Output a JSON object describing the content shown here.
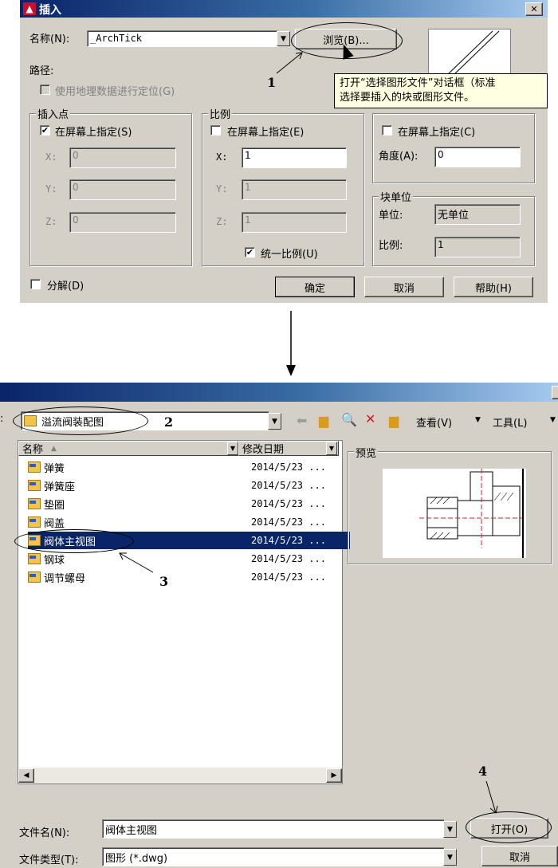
{
  "insert_dialog": {
    "title": "插入",
    "close_label": "✕",
    "name_label": "名称(N):",
    "name_value": "_ArchTick",
    "browse_button": "浏览(B)...",
    "path_label": "路径:",
    "geo_label": "使用地理数据进行定位(G)",
    "tooltip_line1": "打开“选择图形文件”对话框（标准",
    "tooltip_line2": "选择要插入的块或图形文件。",
    "insert_point": {
      "title": "插入点",
      "specify_label": "在屏幕上指定(S)",
      "specify_checked": "✔",
      "x_label": "X:",
      "x_value": "0",
      "y_label": "Y:",
      "y_value": "0",
      "z_label": "Z:",
      "z_value": "0"
    },
    "scale": {
      "title": "比例",
      "specify_label": "在屏幕上指定(E)",
      "x_label": "X:",
      "x_value": "1",
      "y_label": "Y:",
      "y_value": "1",
      "z_label": "Z:",
      "z_value": "1",
      "uniform_label": "统一比例(U)",
      "uniform_checked": "✔"
    },
    "rotation": {
      "specify_label": "在屏幕上指定(C)",
      "angle_label": "角度(A):",
      "angle_value": "0"
    },
    "block_unit": {
      "title": "块单位",
      "unit_label": "单位:",
      "unit_value": "无单位",
      "factor_label": "比例:",
      "factor_value": "1"
    },
    "explode_label": "分解(D)",
    "ok_button": "确定",
    "cancel_button": "取消",
    "help_button": "帮助(H)"
  },
  "annotations": {
    "n1": "1",
    "n2": "2",
    "n3": "3",
    "n4": "4"
  },
  "file_dialog": {
    "location_value": "溢流阀装配图",
    "view_menu": "查看(V)",
    "tools_menu": "工具(L)",
    "col_name": "名称",
    "col_date": "修改日期",
    "preview_label": "预览",
    "files": [
      {
        "name": "弹簧",
        "date": "2014/5/23 ..."
      },
      {
        "name": "弹簧座",
        "date": "2014/5/23 ..."
      },
      {
        "name": "垫圈",
        "date": "2014/5/23 ..."
      },
      {
        "name": "阀盖",
        "date": "2014/5/23 ..."
      },
      {
        "name": "阀体主视图",
        "date": "2014/5/23 ..."
      },
      {
        "name": "钢球",
        "date": "2014/5/23 ..."
      },
      {
        "name": "调节螺母",
        "date": "2014/5/23 ..."
      }
    ],
    "selected_index": 4,
    "filename_label": "文件名(N):",
    "filename_value": "阀体主视图",
    "filetype_label": "文件类型(T):",
    "filetype_value": "图形 (*.dwg)",
    "open_button": "打开(O)",
    "cancel_button": "取消"
  },
  "colors": {
    "selection": "#0a246a",
    "dialog_bg": "#d4d0c8",
    "tooltip_bg": "#ffffe1"
  }
}
